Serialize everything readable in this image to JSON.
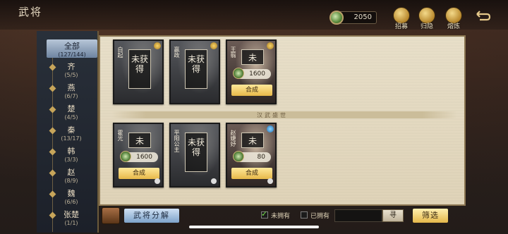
{
  "header": {
    "title": "武将",
    "currency": {
      "icon": "jade-coin-icon",
      "value": "2050"
    },
    "buttons": [
      {
        "label": "招募",
        "icon": "recruit-scroll-icon"
      },
      {
        "label": "归隐",
        "icon": "retire-icon"
      },
      {
        "label": "熔炼",
        "icon": "smelt-icon"
      }
    ],
    "back_icon": "return-arrow-icon"
  },
  "nav": {
    "items": [
      {
        "label": "全部",
        "count": "(127/144)",
        "active": true
      },
      {
        "label": "齐",
        "count": "(5/5)"
      },
      {
        "label": "燕",
        "count": "(6/7)"
      },
      {
        "label": "楚",
        "count": "(4/5)"
      },
      {
        "label": "秦",
        "count": "(13/17)"
      },
      {
        "label": "韩",
        "count": "(3/3)"
      },
      {
        "label": "赵",
        "count": "(8/9)"
      },
      {
        "label": "魏",
        "count": "(6/6)"
      },
      {
        "label": "张楚",
        "count": "(1/1)"
      }
    ]
  },
  "main": {
    "section_title": "汉武盛世",
    "cards": [
      {
        "name": "白起",
        "status": "未获得",
        "badge": "gold"
      },
      {
        "name": "嬴政",
        "status": "未获得",
        "badge": "gold"
      },
      {
        "name": "王翦",
        "status": "未",
        "cost": "1600",
        "action": "合成",
        "badge": "gold"
      },
      {
        "name": "霍光",
        "status": "未",
        "cost": "1600",
        "action": "合成"
      },
      {
        "name": "平阳公主",
        "status": "未获得"
      },
      {
        "name": "赵婕妤",
        "status": "未",
        "cost": "80",
        "action": "合成",
        "badge": "blue"
      }
    ]
  },
  "footer": {
    "decompose_label": "武将分解",
    "unowned_label": "未拥有",
    "owned_label": "已拥有",
    "search_button": "寻",
    "filter_label": "筛选"
  }
}
